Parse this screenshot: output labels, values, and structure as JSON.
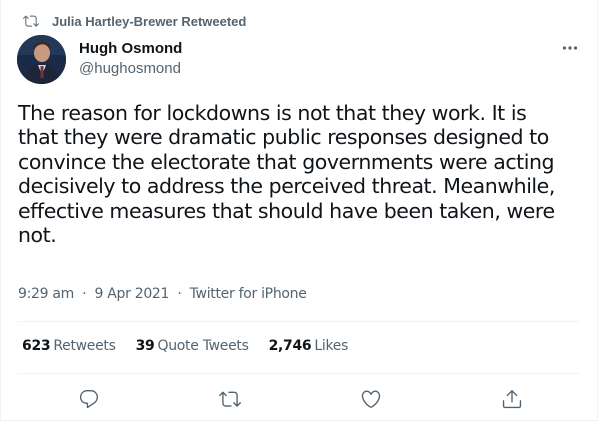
{
  "retweet_banner": {
    "text": "Julia Hartley-Brewer Retweeted",
    "icon": "retweet-icon"
  },
  "author": {
    "name": "Hugh Osmond",
    "handle": "@hughosmond"
  },
  "tweet": {
    "text": "The reason for lockdowns is not that they work. It is\nthat they were dramatic public responses designed to\nconvince the electorate that governments were acting\ndecisively to address the perceived threat. Meanwhile,\neffective measures that should have been taken, were\nnot.",
    "time": "9:29 am",
    "date": "9 Apr 2021",
    "source": "Twitter for iPhone",
    "separator": "·"
  },
  "stats": {
    "retweets_count": "623",
    "retweets_label": "Retweets",
    "quotes_count": "39",
    "quotes_label": "Quote Tweets",
    "likes_count": "2,746",
    "likes_label": "Likes"
  },
  "actions": [
    "reply-icon",
    "retweet-icon",
    "like-icon",
    "share-icon"
  ],
  "colors": {
    "text_primary": "#0f1419",
    "text_secondary": "#536471",
    "divider": "#eff3f4"
  }
}
